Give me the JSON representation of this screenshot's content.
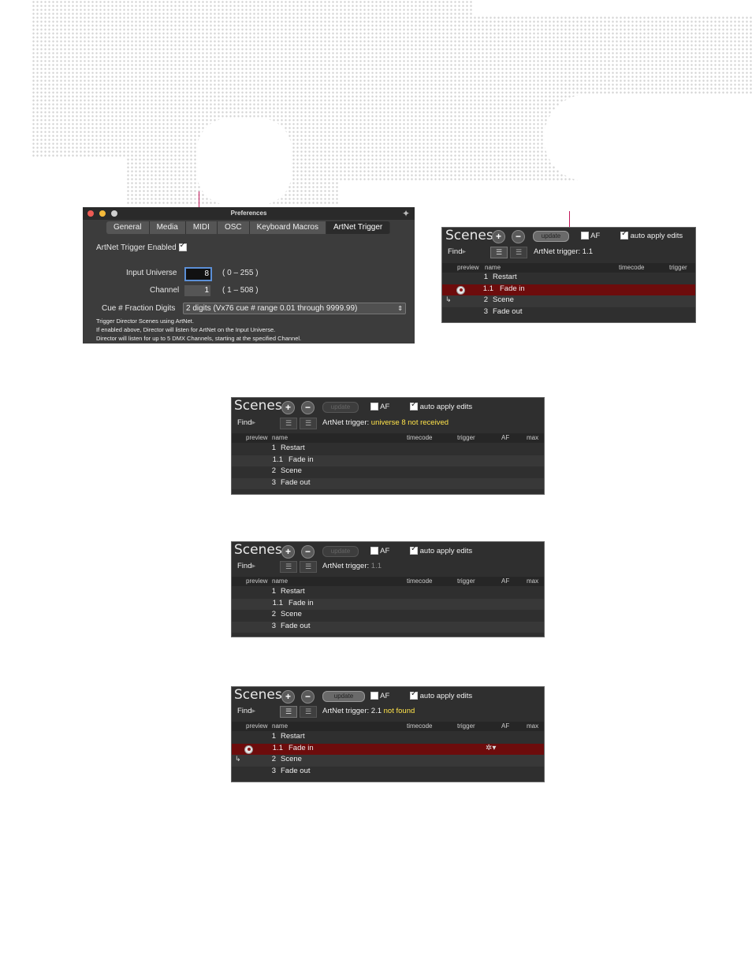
{
  "prefs": {
    "title": "Preferences",
    "tabs": [
      "General",
      "Media",
      "MIDI",
      "OSC",
      "Keyboard Macros",
      "ArtNet Trigger"
    ],
    "enabled_label": "ArtNet Trigger Enabled",
    "input_universe_label": "Input Universe",
    "input_universe_value": "8",
    "input_universe_range": "( 0 – 255 )",
    "channel_label": "Channel",
    "channel_value": "1",
    "channel_range": "( 1 – 508 )",
    "fraction_label": "Cue # Fraction Digits",
    "fraction_value": "2 digits (Vx76 cue # range 0.01 through 9999.99)",
    "note1": "Trigger Director Scenes using ArtNet.",
    "note2": "If enabled above, Director will listen for ArtNet on the Input Universe.",
    "note3": "Director will listen for up to 5 DMX Channels, starting at the specified Channel."
  },
  "common": {
    "scenes_title": "Scenes",
    "update_label": "update",
    "af_label": "AF",
    "auto_apply_label": "auto apply edits",
    "find_label": "Find",
    "artnet_label": "ArtNet trigger:",
    "col_preview": "preview",
    "col_name": "name",
    "col_timecode": "timecode",
    "col_trigger": "trigger",
    "col_af": "AF",
    "col_max": "max"
  },
  "panel_a": {
    "status": "1.1",
    "rows": [
      {
        "num": "1",
        "name": "Restart"
      },
      {
        "num": "1.1",
        "name": "Fade in"
      },
      {
        "num": "2",
        "name": "Scene"
      },
      {
        "num": "3",
        "name": "Fade out"
      }
    ]
  },
  "panel_b": {
    "status_prefix": "universe 8 not received",
    "rows": [
      {
        "num": "1",
        "name": "Restart"
      },
      {
        "num": "1.1",
        "name": "Fade in"
      },
      {
        "num": "2",
        "name": "Scene"
      },
      {
        "num": "3",
        "name": "Fade out"
      }
    ]
  },
  "panel_c": {
    "status": "1.1",
    "rows": [
      {
        "num": "1",
        "name": "Restart"
      },
      {
        "num": "1.1",
        "name": "Fade in"
      },
      {
        "num": "2",
        "name": "Scene"
      },
      {
        "num": "3",
        "name": "Fade out"
      }
    ]
  },
  "panel_d": {
    "status_value": "2.1",
    "status_suffix": "not found",
    "rows": [
      {
        "num": "1",
        "name": "Restart"
      },
      {
        "num": "1.1",
        "name": "Fade in"
      },
      {
        "num": "2",
        "name": "Scene"
      },
      {
        "num": "3",
        "name": "Fade out"
      }
    ]
  },
  "colors": {
    "selected_row": "#6d0c0c",
    "warning_text": "#ffe34a",
    "callout": "#c2185b"
  }
}
